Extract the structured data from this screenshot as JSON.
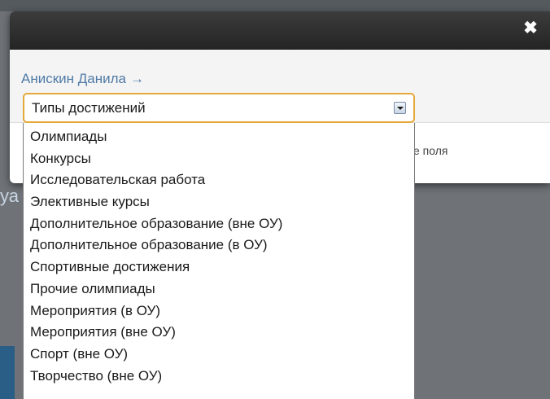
{
  "background": {
    "left_char": "уа"
  },
  "modal": {
    "close_icon_glyph": "✖",
    "student_name": "Анискин Данила",
    "arrow": "→",
    "footer_fragment": "е поля"
  },
  "select": {
    "selected_value": "Типы достижений",
    "options": [
      "Олимпиады",
      "Конкурсы",
      "Исследовательская работа",
      "Элективные курсы",
      "Дополнительное образование (вне ОУ)",
      "Дополнительное образование (в ОУ)",
      "Спортивные достижения",
      "Прочие олимпиады",
      "Мероприятия (в ОУ)",
      "Мероприятия (вне ОУ)",
      "Спорт (вне ОУ)",
      "Творчество (вне ОУ)"
    ]
  },
  "colors": {
    "header_bg": "#2f2f2f",
    "link": "#4f7aa6",
    "select_focus_border": "#e5a83b",
    "overlay": "#6f7378"
  }
}
